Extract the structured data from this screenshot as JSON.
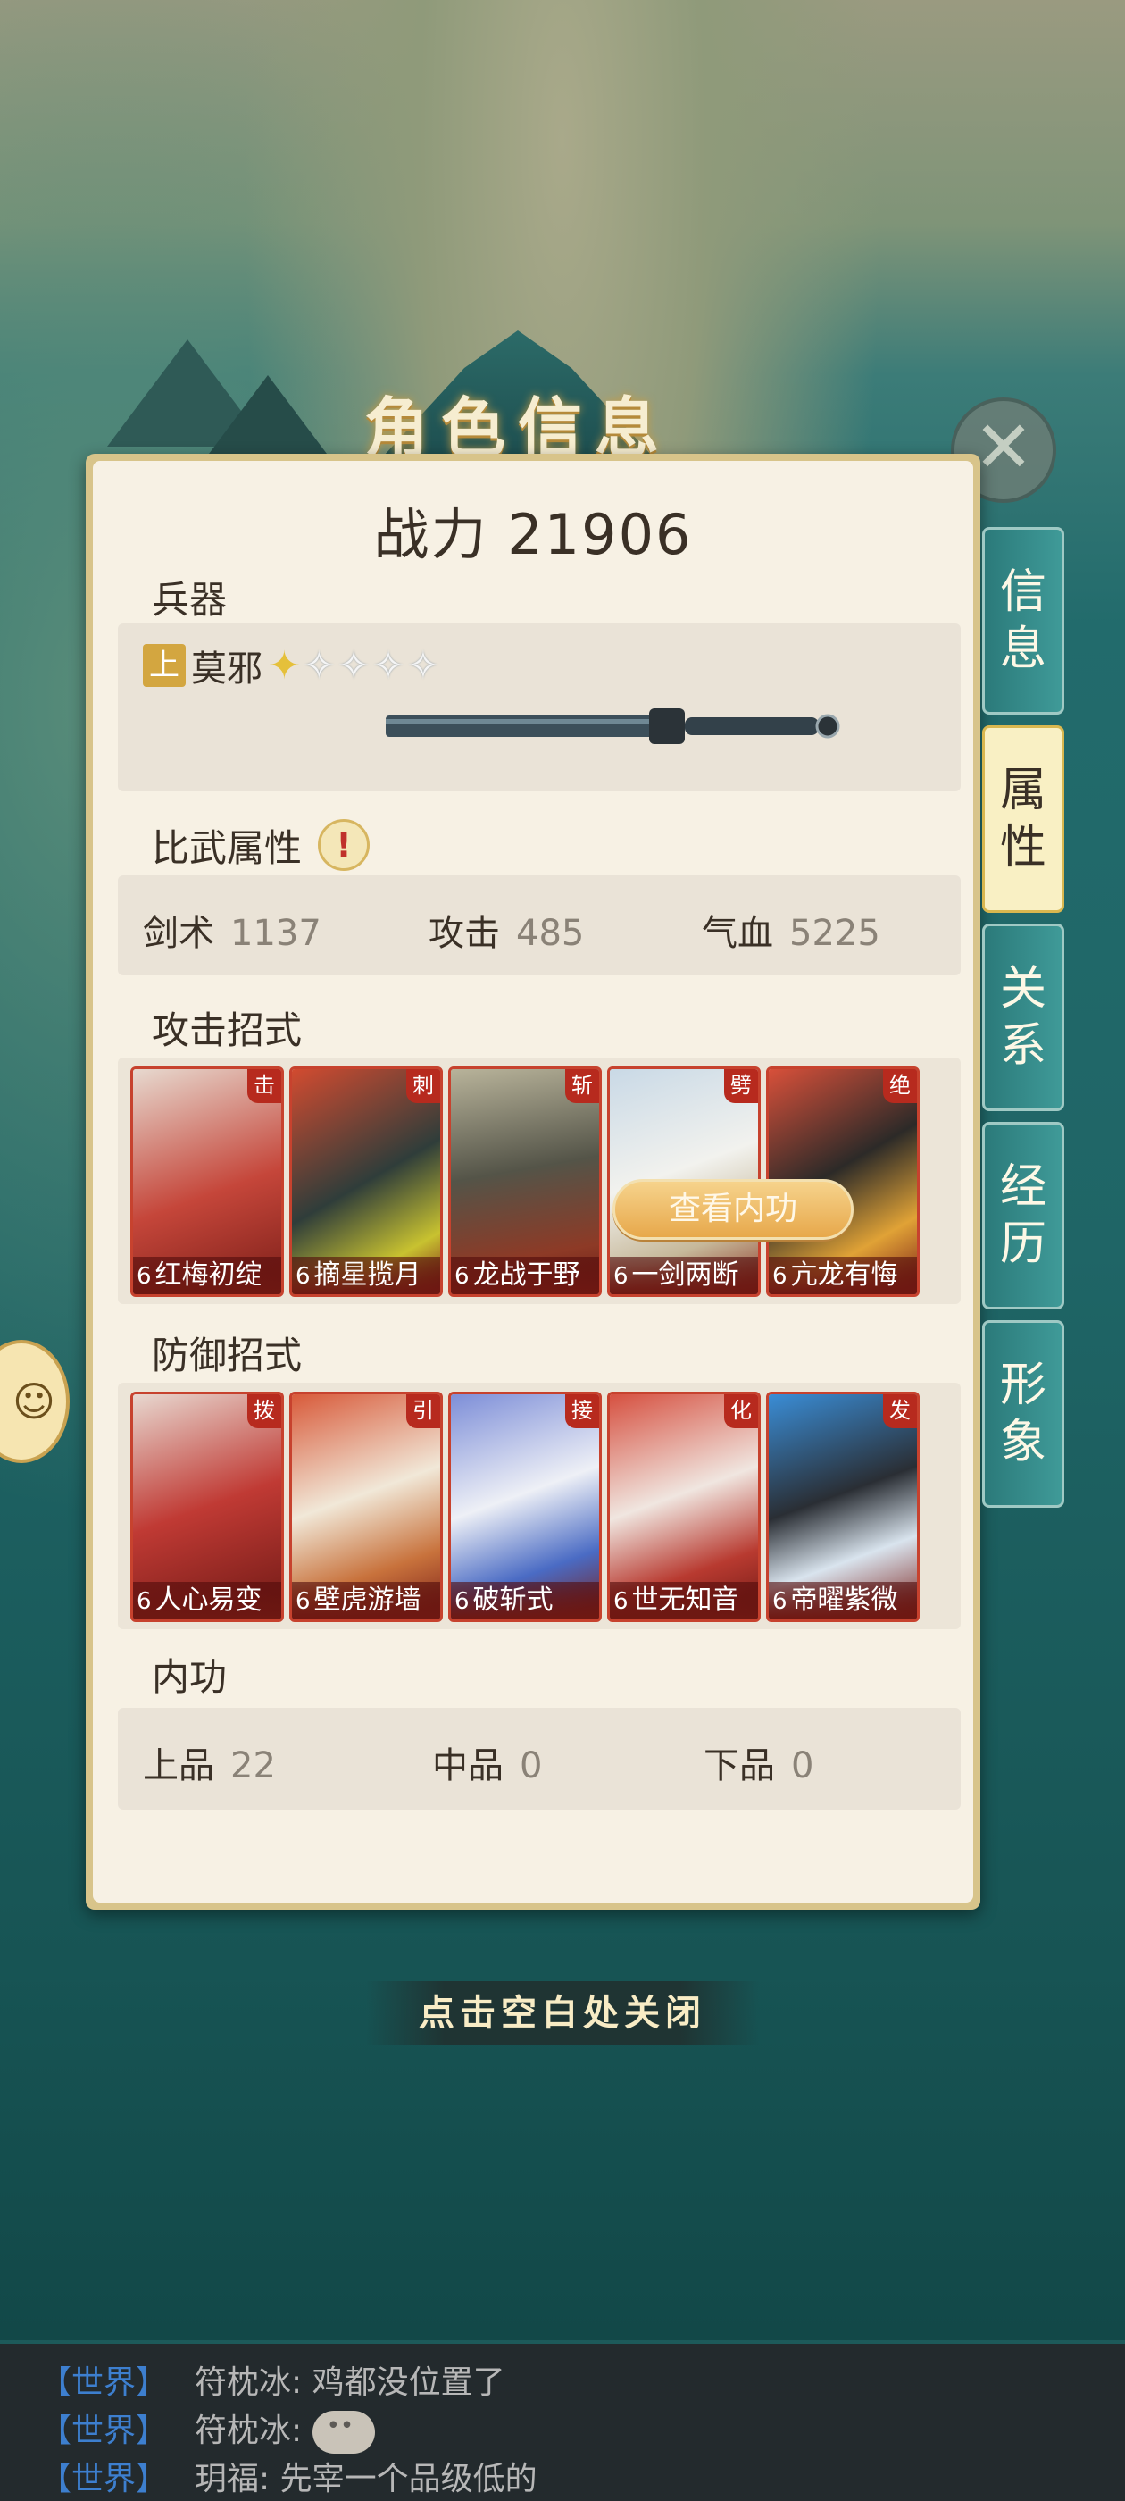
{
  "window_title": "角色信息",
  "power": "战力 21906",
  "weapon": {
    "section_label": "兵器",
    "grade": "上",
    "name": "莫邪",
    "stars_filled": 1,
    "stars_total": 5
  },
  "duel_stats": {
    "section_label": "比武属性",
    "warning_icon": "exclamation-icon",
    "items": [
      {
        "label": "剑术",
        "value": "1137"
      },
      {
        "label": "攻击",
        "value": "485"
      },
      {
        "label": "气血",
        "value": "5225"
      }
    ]
  },
  "attack_moves": {
    "section_label": "攻击招式",
    "cards": [
      {
        "tag": "击",
        "level": "6",
        "name": "红梅初绽"
      },
      {
        "tag": "刺",
        "level": "6",
        "name": "摘星揽月"
      },
      {
        "tag": "斩",
        "level": "6",
        "name": "龙战于野"
      },
      {
        "tag": "劈",
        "level": "6",
        "name": "一剑两断"
      },
      {
        "tag": "绝",
        "level": "6",
        "name": "亢龙有悔"
      }
    ]
  },
  "defense_moves": {
    "section_label": "防御招式",
    "cards": [
      {
        "tag": "拨",
        "level": "6",
        "name": "人心易变"
      },
      {
        "tag": "引",
        "level": "6",
        "name": "壁虎游墙"
      },
      {
        "tag": "接",
        "level": "6",
        "name": "破斩式"
      },
      {
        "tag": "化",
        "level": "6",
        "name": "世无知音"
      },
      {
        "tag": "发",
        "level": "6",
        "name": "帝曜紫微"
      }
    ]
  },
  "neigong": {
    "section_label": "内功",
    "button_label": "查看内功",
    "items": [
      {
        "label": "上品",
        "value": "22"
      },
      {
        "label": "中品",
        "value": "0"
      },
      {
        "label": "下品",
        "value": "0"
      }
    ]
  },
  "tabs": [
    {
      "line1": "信",
      "line2": "息"
    },
    {
      "line1": "属",
      "line2": "性"
    },
    {
      "line1": "关",
      "line2": "系"
    },
    {
      "line1": "经",
      "line2": "历"
    },
    {
      "line1": "形",
      "line2": "象"
    }
  ],
  "active_tab": 1,
  "close_hint": "点击空白处关闭",
  "chat": [
    {
      "channel": "【世界】",
      "text": "符枕冰: 鸡都没位置了"
    },
    {
      "channel": "【世界】",
      "text": "符枕冰: "
    },
    {
      "channel": "【世界】",
      "text": "玥福: 先宰一个品级低的"
    }
  ],
  "colors": {
    "card_frame": "#c7422e",
    "tab_teal": "#2b7a7a",
    "tab_active": "#f9f0c4",
    "chat_channel": "#3d7fcf"
  }
}
